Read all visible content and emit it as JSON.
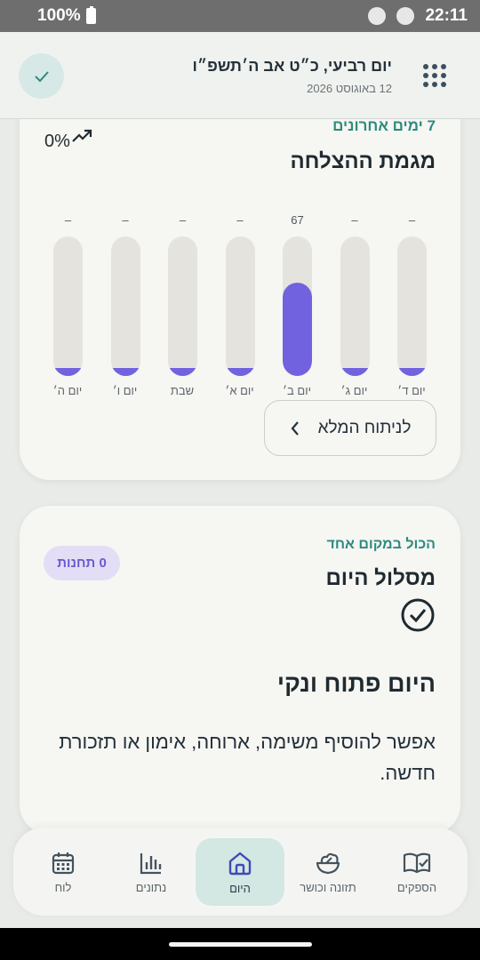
{
  "status_bar": {
    "battery": "100%",
    "time": "22:11"
  },
  "header": {
    "title": "יום רביעי, כ״ט אב ה׳תשפ״ו",
    "subtitle": "12 באוגוסט 2026"
  },
  "success_card": {
    "eyebrow": "7 ימים אחרונים",
    "title": "מגמת ההצלחה",
    "trend_value": "0%",
    "full_analysis_label": "לניתוח המלא",
    "chart_data": {
      "type": "bar",
      "categories": [
        "יום ה׳",
        "יום ו׳",
        "שבת",
        "יום א׳",
        "יום ב׳",
        "יום ג׳",
        "יום ד׳"
      ],
      "values": [
        null,
        null,
        null,
        null,
        67,
        null,
        null
      ],
      "value_labels": [
        "–",
        "–",
        "–",
        "–",
        "67",
        "–",
        "–"
      ],
      "ylim": [
        0,
        100
      ],
      "bar_color": "#7162e0",
      "track_color": "#e5e3dd"
    }
  },
  "route_card": {
    "eyebrow": "הכול במקום אחד",
    "title": "מסלול היום",
    "badge": "0 תחנות",
    "empty_title": "היום פתוח ונקי",
    "empty_text": "אפשר להוסיף משימה, ארוחה, אימון או תזכורת חדשה."
  },
  "bottom_nav": {
    "items": [
      {
        "label": "לוח",
        "icon": "calendar-icon"
      },
      {
        "label": "נתונים",
        "icon": "bar-chart-icon"
      },
      {
        "label": "היום",
        "icon": "home-icon",
        "active": true
      },
      {
        "label": "תזונה וכושר",
        "icon": "salad-bowl-icon"
      },
      {
        "label": "הספקים",
        "icon": "book-check-icon"
      }
    ]
  },
  "colors": {
    "accent": "#2e8b7e",
    "chart": "#7162e0",
    "active_nav": "#d3e7e3"
  }
}
